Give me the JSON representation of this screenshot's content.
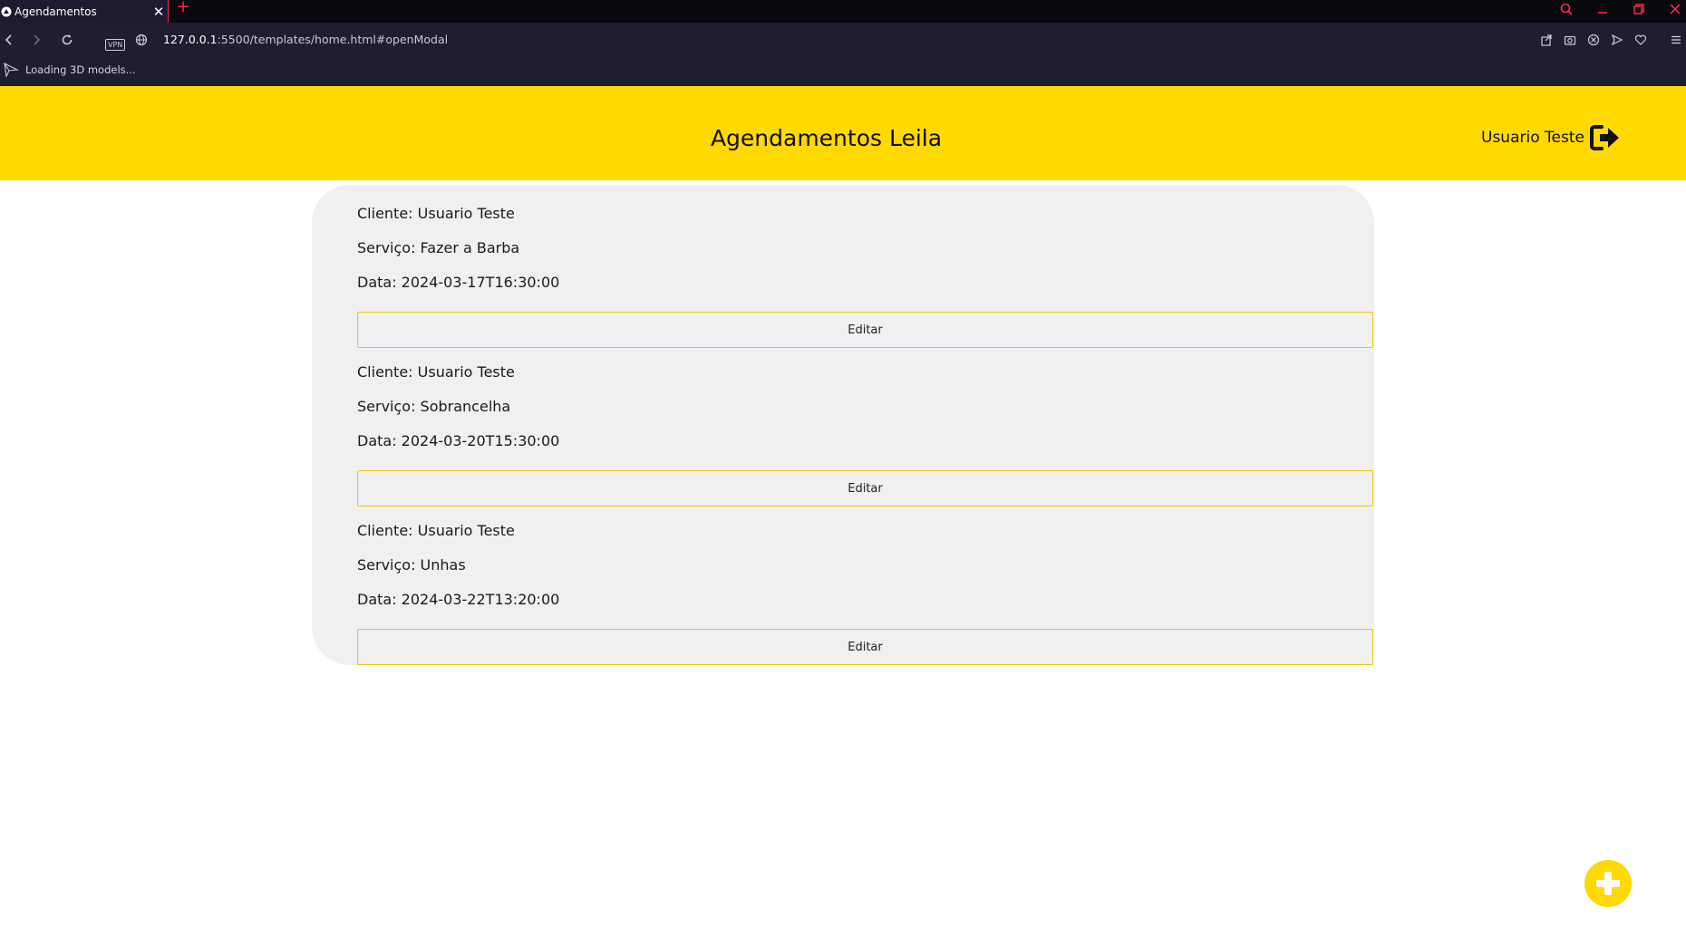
{
  "browser": {
    "tab_title": "Agendamentos",
    "url_host": "127.0.0.1",
    "url_rest": ":5500/templates/home.html#openModal",
    "vpn_label": "VPN",
    "status_text": "Loading 3D models..."
  },
  "header": {
    "title": "Agendamentos Leila",
    "user_name": "Usuario Teste"
  },
  "appointments": [
    {
      "client": "Cliente: Usuario Teste",
      "service": "Serviço: Fazer a Barba",
      "date": "Data: 2024-03-17T16:30:00",
      "edit_label": "Editar"
    },
    {
      "client": "Cliente: Usuario Teste",
      "service": "Serviço: Sobrancelha",
      "date": "Data: 2024-03-20T15:30:00",
      "edit_label": "Editar"
    },
    {
      "client": "Cliente: Usuario Teste",
      "service": "Serviço: Unhas",
      "date": "Data: 2024-03-22T13:20:00",
      "edit_label": "Editar"
    }
  ],
  "icons": {
    "logout": "logout-icon",
    "add": "add-icon"
  },
  "colors": {
    "accent": "#ffd900",
    "card_bg": "#f0f0f0",
    "browser_accent": "#ff2a4d"
  }
}
